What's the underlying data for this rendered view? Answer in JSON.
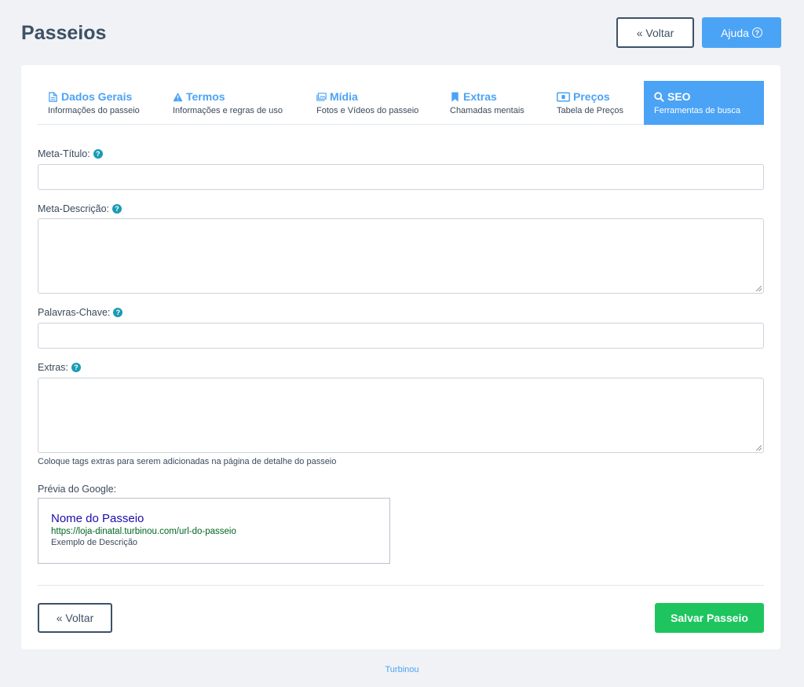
{
  "header": {
    "title": "Passeios",
    "back_label": "« Voltar",
    "help_label": "Ajuda",
    "help_glyph": "?"
  },
  "tabs": [
    {
      "label": "Dados Gerais",
      "sub": "Informações do passeio",
      "icon": "document-icon"
    },
    {
      "label": "Termos",
      "sub": "Informações e regras de uso",
      "icon": "warning-icon"
    },
    {
      "label": "Mídia",
      "sub": "Fotos e Vídeos do passeio",
      "icon": "images-icon"
    },
    {
      "label": "Extras",
      "sub": "Chamadas mentais",
      "icon": "bookmark-icon"
    },
    {
      "label": "Preços",
      "sub": "Tabela de Preços",
      "icon": "money-icon"
    },
    {
      "label": "SEO",
      "sub": "Ferramentas de busca",
      "icon": "search-icon"
    }
  ],
  "form": {
    "meta_title_label": "Meta-Título:",
    "meta_title_value": "",
    "meta_description_label": "Meta-Descrição:",
    "meta_description_value": "",
    "keywords_label": "Palavras-Chave:",
    "keywords_value": "",
    "extras_label": "Extras:",
    "extras_value": "",
    "extras_help": "Coloque tags extras para serem adicionadas na página de detalhe do passeio",
    "q_glyph": "?"
  },
  "preview": {
    "label": "Prévia do Google:",
    "title": "Nome do Passeio",
    "url": "https://loja-dinatal.turbinou.com/url-do-passeio",
    "description": "Exemplo de Descrição"
  },
  "actions": {
    "back_label": "« Voltar",
    "save_label": "Salvar Passeio"
  },
  "footer": {
    "text": "Turbinou"
  },
  "colors": {
    "accent": "#4ba3f5",
    "save": "#1ec55f",
    "info": "#1a9bb5",
    "title": "#3d5166"
  }
}
